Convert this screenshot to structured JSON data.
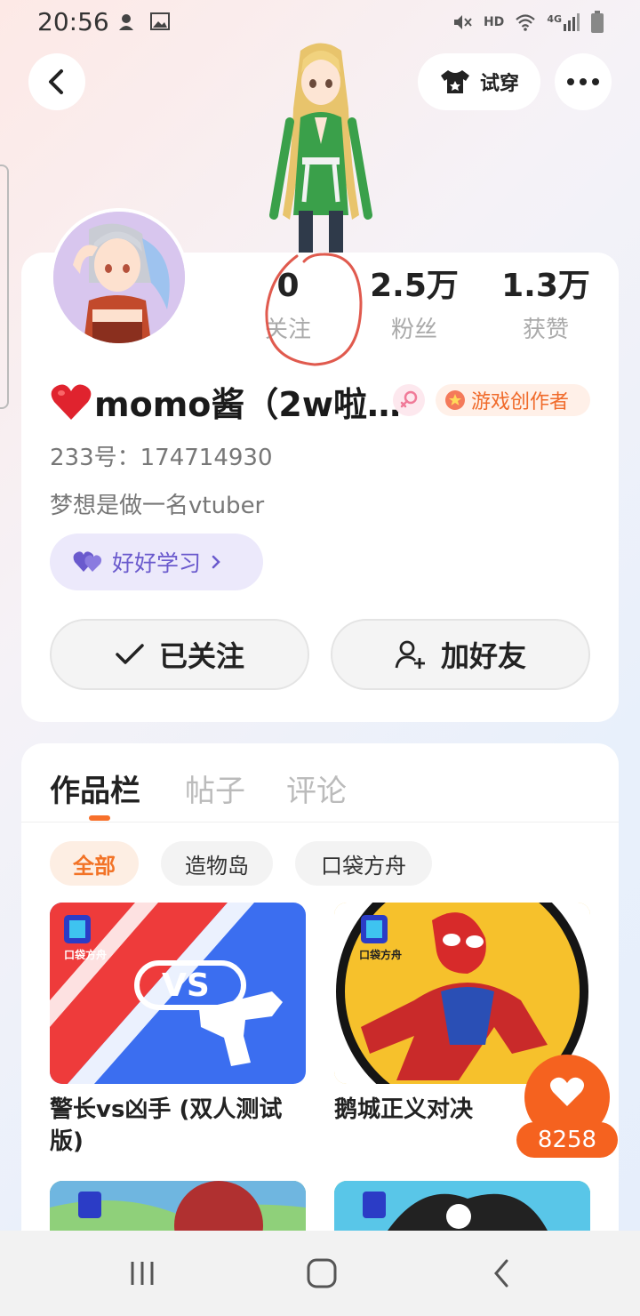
{
  "status_bar": {
    "time": "20:56",
    "left_icons": [
      "app-notification-icon",
      "image-icon"
    ],
    "right_icons": [
      "mute-icon",
      "hd-icon",
      "wifi-icon",
      "signal-4g-icon",
      "battery-icon"
    ],
    "hd_label": "HD",
    "network_label": "4G"
  },
  "top_bar": {
    "tryon_label": "试穿"
  },
  "profile": {
    "stats": [
      {
        "value": "0",
        "label": "关注"
      },
      {
        "value": "2.5万",
        "label": "粉丝"
      },
      {
        "value": "1.3万",
        "label": "获赞"
      }
    ],
    "username": "momo酱（2w啦…",
    "creator_badge": "游戏创作者",
    "user_id": "233号：174714930",
    "bio": "梦想是做一名vtuber",
    "tag_label": "好好学习",
    "follow_label": "已关注",
    "add_friend_label": "加好友"
  },
  "works": {
    "tabs": [
      "作品栏",
      "帖子",
      "评论"
    ],
    "chips": [
      "全部",
      "造物岛",
      "口袋方舟"
    ],
    "games": [
      {
        "title": "警长vs凶手 (双人测试版)",
        "thumb_text": "VS",
        "brand": "口袋方舟"
      },
      {
        "title": "鹅城正义对决",
        "brand": "口袋方舟"
      }
    ],
    "like_count": "8258"
  },
  "colors": {
    "accent": "#f5621f",
    "tag_purple": "#6a5acd",
    "vs_red": "#ee3b3b",
    "vs_blue": "#3b6ef0"
  }
}
